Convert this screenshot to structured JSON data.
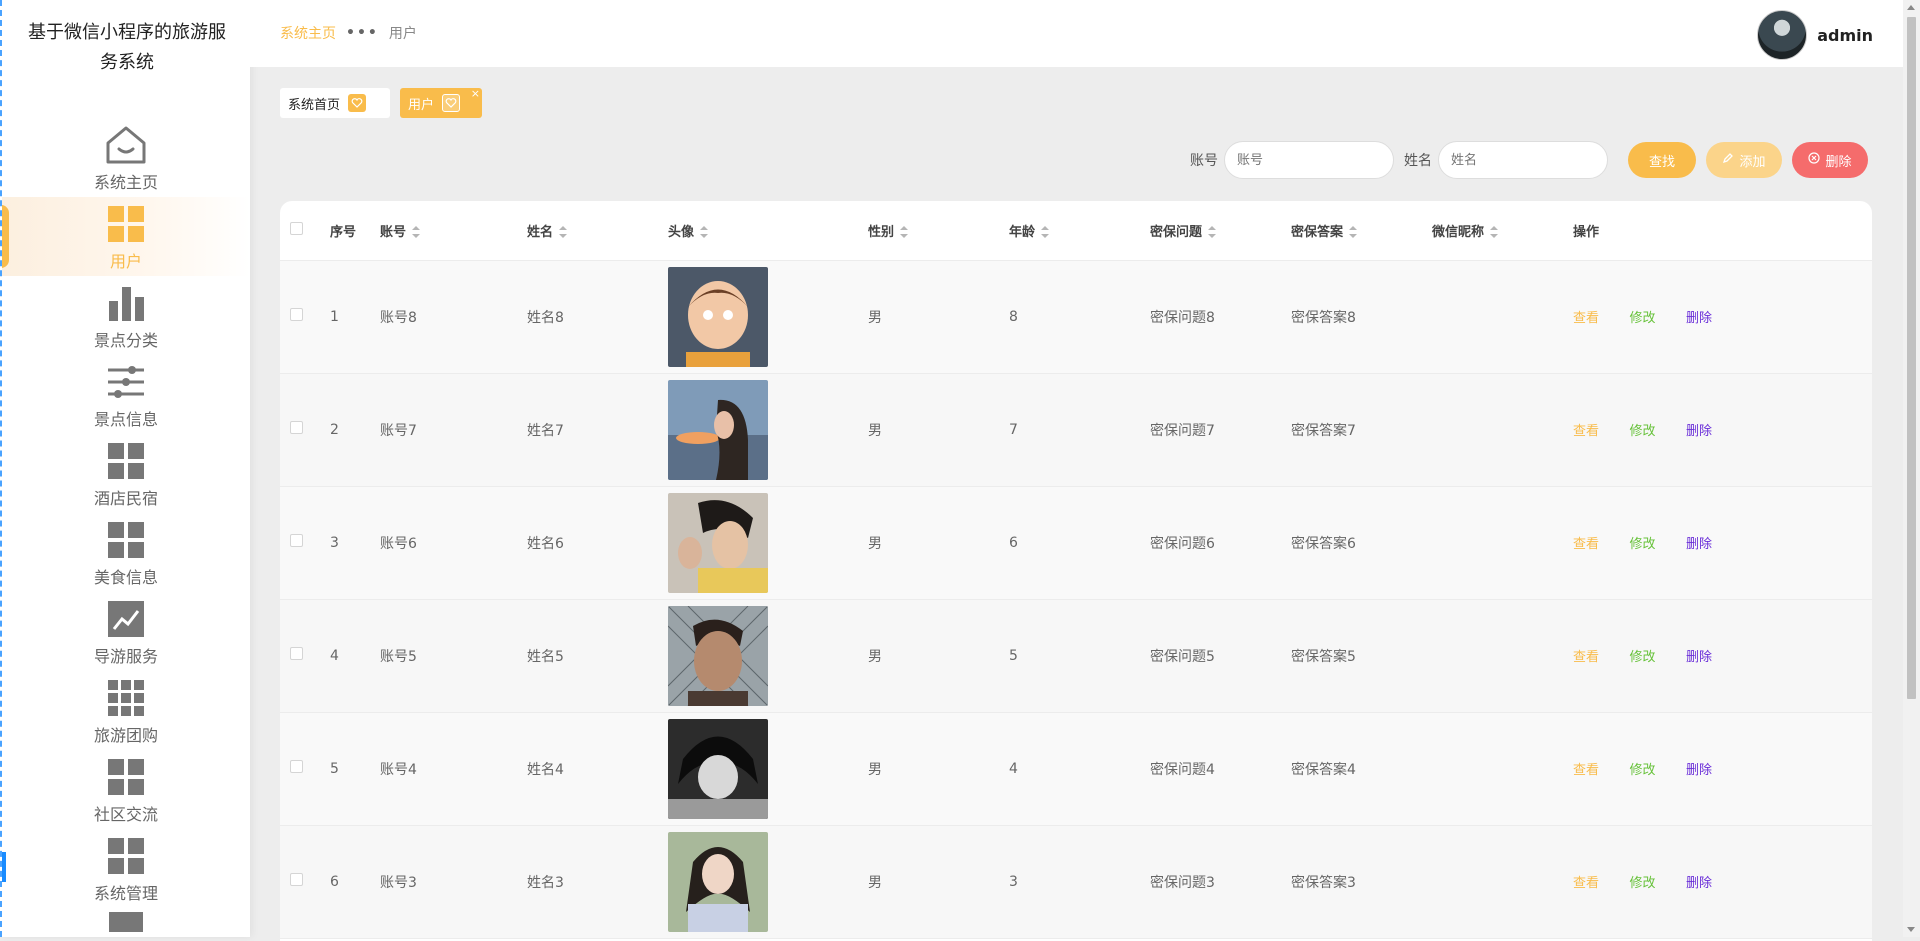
{
  "brand": {
    "title_line1": "基于微信小程序的旅游服",
    "title_line2": "务系统"
  },
  "sidebar": {
    "items": [
      {
        "label": "系统主页",
        "icon": "home-icon",
        "active": false
      },
      {
        "label": "用户",
        "icon": "grid-four-icon",
        "active": true
      },
      {
        "label": "景点分类",
        "icon": "bar-chart-icon",
        "active": false
      },
      {
        "label": "景点信息",
        "icon": "sliders-icon",
        "active": false
      },
      {
        "label": "酒店民宿",
        "icon": "grid-four-icon",
        "active": false
      },
      {
        "label": "美食信息",
        "icon": "grid-four-icon",
        "active": false
      },
      {
        "label": "导游服务",
        "icon": "line-chart-icon",
        "active": false
      },
      {
        "label": "旅游团购",
        "icon": "grid-nine-icon",
        "active": false
      },
      {
        "label": "社区交流",
        "icon": "grid-four-icon",
        "active": false
      },
      {
        "label": "系统管理",
        "icon": "grid-four-icon",
        "active": false
      }
    ]
  },
  "header": {
    "breadcrumb_home": "系统主页",
    "breadcrumb_sep": "•••",
    "breadcrumb_current": "用户",
    "username": "admin"
  },
  "tabs": [
    {
      "label": "系统首页"
    },
    {
      "label": "用户",
      "close": "×"
    }
  ],
  "search": {
    "account_label": "账号",
    "account_placeholder": "账号",
    "name_label": "姓名",
    "name_placeholder": "姓名",
    "search_button": "查找",
    "add_button": "添加",
    "delete_button": "删除"
  },
  "table": {
    "columns": {
      "index": "序号",
      "account": "账号",
      "name": "姓名",
      "avatar": "头像",
      "gender": "性别",
      "age": "年龄",
      "question": "密保问题",
      "answer": "密保答案",
      "nickname": "微信昵称",
      "actions": "操作"
    },
    "action_labels": {
      "view": "查看",
      "edit": "修改",
      "delete": "删除"
    },
    "rows": [
      {
        "index": "1",
        "account": "账号8",
        "name": "姓名8",
        "gender": "男",
        "age": "8",
        "question": "密保问题8",
        "answer": "密保答案8",
        "nickname": ""
      },
      {
        "index": "2",
        "account": "账号7",
        "name": "姓名7",
        "gender": "男",
        "age": "7",
        "question": "密保问题7",
        "answer": "密保答案7",
        "nickname": ""
      },
      {
        "index": "3",
        "account": "账号6",
        "name": "姓名6",
        "gender": "男",
        "age": "6",
        "question": "密保问题6",
        "answer": "密保答案6",
        "nickname": ""
      },
      {
        "index": "4",
        "account": "账号5",
        "name": "姓名5",
        "gender": "男",
        "age": "5",
        "question": "密保问题5",
        "answer": "密保答案5",
        "nickname": ""
      },
      {
        "index": "5",
        "account": "账号4",
        "name": "姓名4",
        "gender": "男",
        "age": "4",
        "question": "密保问题4",
        "answer": "密保答案4",
        "nickname": ""
      },
      {
        "index": "6",
        "account": "账号3",
        "name": "姓名3",
        "gender": "男",
        "age": "3",
        "question": "密保问题3",
        "answer": "密保答案3",
        "nickname": ""
      }
    ]
  },
  "colors": {
    "accent": "#f9bc4b",
    "edit": "#67c23a",
    "delete_link": "#6a2ed8",
    "danger": "#f56c6c"
  }
}
